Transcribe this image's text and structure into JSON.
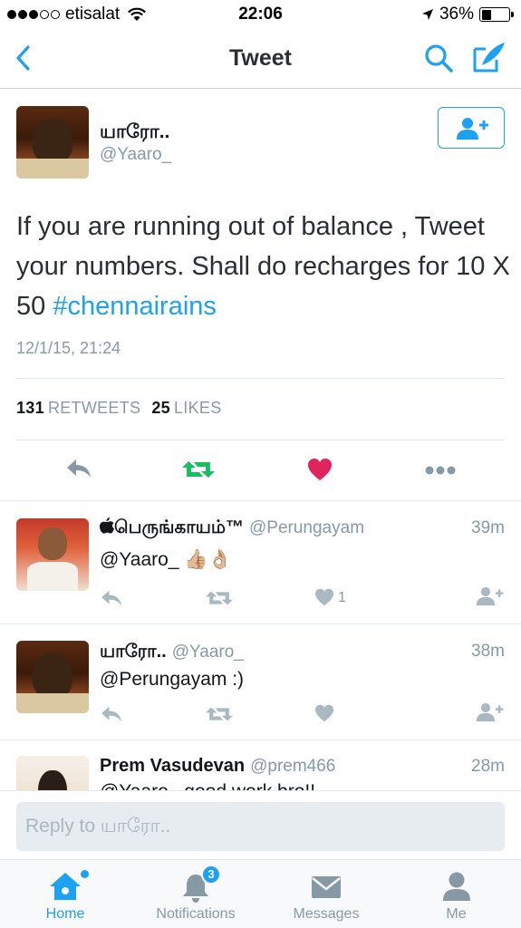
{
  "status_bar": {
    "carrier": "etisalat",
    "time": "22:06",
    "battery": "36%",
    "battery_level": 0.36
  },
  "nav": {
    "title": "Tweet",
    "back_icon": "chevron-left-icon",
    "search_icon": "search-icon",
    "compose_icon": "compose-icon"
  },
  "tweet": {
    "name": "யாரோ..",
    "handle": "@Yaaro_",
    "text_part1": "If you are running out of balance , Tweet your numbers.  Shall do recharges for 10 X 50 ",
    "hashtag": "#chennairains",
    "timestamp": "12/1/15, 21:24",
    "retweets_count": "131",
    "retweets_label": "RETWEETS",
    "likes_count": "25",
    "likes_label": "LIKES",
    "retweeted": true,
    "liked": true
  },
  "replies": [
    {
      "name": "பெருங்காயம்™",
      "handle": "@Perungayam",
      "time": "39m",
      "text": "@Yaaro_ 👍🏼👌🏼",
      "like_count": "1"
    },
    {
      "name": "யாரோ..",
      "handle": "@Yaaro_",
      "time": "38m",
      "text": "@Perungayam :)"
    },
    {
      "name": "Prem Vasudevan",
      "handle": "@prem466",
      "time": "28m",
      "text": "@Yaaro_ good work bro!!"
    }
  ],
  "reply_bar": {
    "placeholder": "Reply to யாரோ.."
  },
  "tabbar": {
    "home": "Home",
    "notifications": "Notifications",
    "notifications_badge": "3",
    "messages": "Messages",
    "me": "Me"
  },
  "colors": {
    "accent": "#1da1f2",
    "retweet": "#17bf63",
    "like": "#e0245e",
    "muted": "#8899a6"
  }
}
